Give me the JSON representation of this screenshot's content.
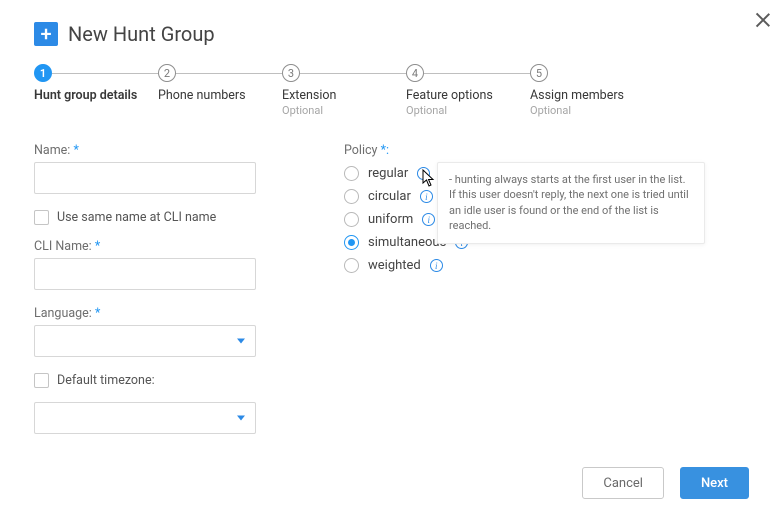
{
  "header": {
    "title": "New Hunt Group"
  },
  "stepper": {
    "steps": [
      {
        "num": "1",
        "label": "Hunt group details",
        "optional": "",
        "active": true
      },
      {
        "num": "2",
        "label": "Phone numbers",
        "optional": ""
      },
      {
        "num": "3",
        "label": "Extension",
        "optional": "Optional"
      },
      {
        "num": "4",
        "label": "Feature options",
        "optional": "Optional"
      },
      {
        "num": "5",
        "label": "Assign members",
        "optional": "Optional"
      }
    ]
  },
  "form": {
    "name_label": "Name:",
    "name_value": "",
    "use_same_name_label": "Use same name at CLI name",
    "use_same_name_checked": false,
    "cli_name_label": "CLI Name:",
    "cli_name_value": "",
    "language_label": "Language:",
    "language_value": "",
    "default_tz_label": "Default timezone:",
    "default_tz_checked": false,
    "tz_value": ""
  },
  "policy": {
    "label": "Policy",
    "options": [
      {
        "key": "regular",
        "label": "regular",
        "selected": false
      },
      {
        "key": "circular",
        "label": "circular",
        "selected": false
      },
      {
        "key": "uniform",
        "label": "uniform",
        "selected": false
      },
      {
        "key": "simultaneous",
        "label": "simultaneous",
        "selected": true
      },
      {
        "key": "weighted",
        "label": "weighted",
        "selected": false
      }
    ],
    "tooltip": "- hunting always starts at the first user in the list. If this user doesn't reply, the next one is tried until an idle user is found or the end of the list is reached."
  },
  "footer": {
    "cancel": "Cancel",
    "next": "Next"
  },
  "required_mark": "*"
}
